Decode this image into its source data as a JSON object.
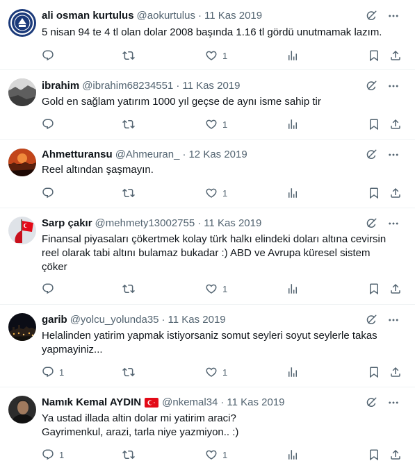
{
  "tweets": [
    {
      "name": "ali osman kurtulus",
      "handle": "@aokurtulus",
      "separator": "·",
      "date": "11 Kas 2019",
      "text": "5 nisan 94 te 4 tl olan dolar 2008 başında 1.16 tl gördü unutmamak lazım.",
      "reply_count": "",
      "like_count": "1",
      "avatar": "avatar-seal-blue"
    },
    {
      "name": "ibrahim",
      "handle": "@ibrahim68234551",
      "separator": "·",
      "date": "11 Kas 2019",
      "text": "Gold en sağlam yatırım 1000 yıl geçse de aynı isme sahip tir",
      "reply_count": "",
      "like_count": "1",
      "avatar": "avatar-photo-grey"
    },
    {
      "name": "Ahmetturansu",
      "handle": "@Ahmeuran_",
      "separator": "·",
      "date": "12 Kas 2019",
      "text": "Reel altından şaşmayın.",
      "reply_count": "",
      "like_count": "1",
      "avatar": "avatar-photo-orange"
    },
    {
      "name": "Sarp çakır",
      "handle": "@mehmety13002755",
      "separator": "·",
      "date": "11 Kas 2019",
      "text": "Finansal piyasaları çökertmek kolay türk halkı elindeki doları altına cevirsin\nreel olarak tabi altını bulamaz bukadar :) ABD ve Avrupa küresel sistem\nçöker",
      "reply_count": "",
      "like_count": "1",
      "avatar": "avatar-turkish-flag"
    },
    {
      "name": "garib",
      "handle": "@yolcu_yolunda35",
      "separator": "·",
      "date": "11 Kas 2019",
      "text": "Helalinden yatirim yapmak istiyorsaniz somut seyleri soyut seylerle takas\nyapmayiniz...",
      "reply_count": "1",
      "like_count": "1",
      "avatar": "avatar-night-city"
    },
    {
      "name": "Namık Kemal AYDIN",
      "handle": "@nkemal34",
      "separator": "·",
      "date": "11 Kas 2019",
      "text": "Ya ustad illada altin dolar mi yatirim araci?\nGayrimenkul,  arazi,  tarla niye yazmiyon.. :)",
      "reply_count": "1",
      "like_count": "1",
      "avatar": "avatar-man-portrait",
      "badge": "turkey-flag-emoji"
    }
  ],
  "icons": {
    "grok": "grok-icon",
    "more": "more-icon",
    "reply": "reply-icon",
    "retweet": "retweet-icon",
    "like": "heart-icon",
    "views": "views-icon",
    "bookmark": "bookmark-icon",
    "share": "share-icon"
  },
  "colors": {
    "text": "#0f1419",
    "secondary": "#536471",
    "divider": "#eff3f4",
    "flag_red": "#e30a17"
  }
}
